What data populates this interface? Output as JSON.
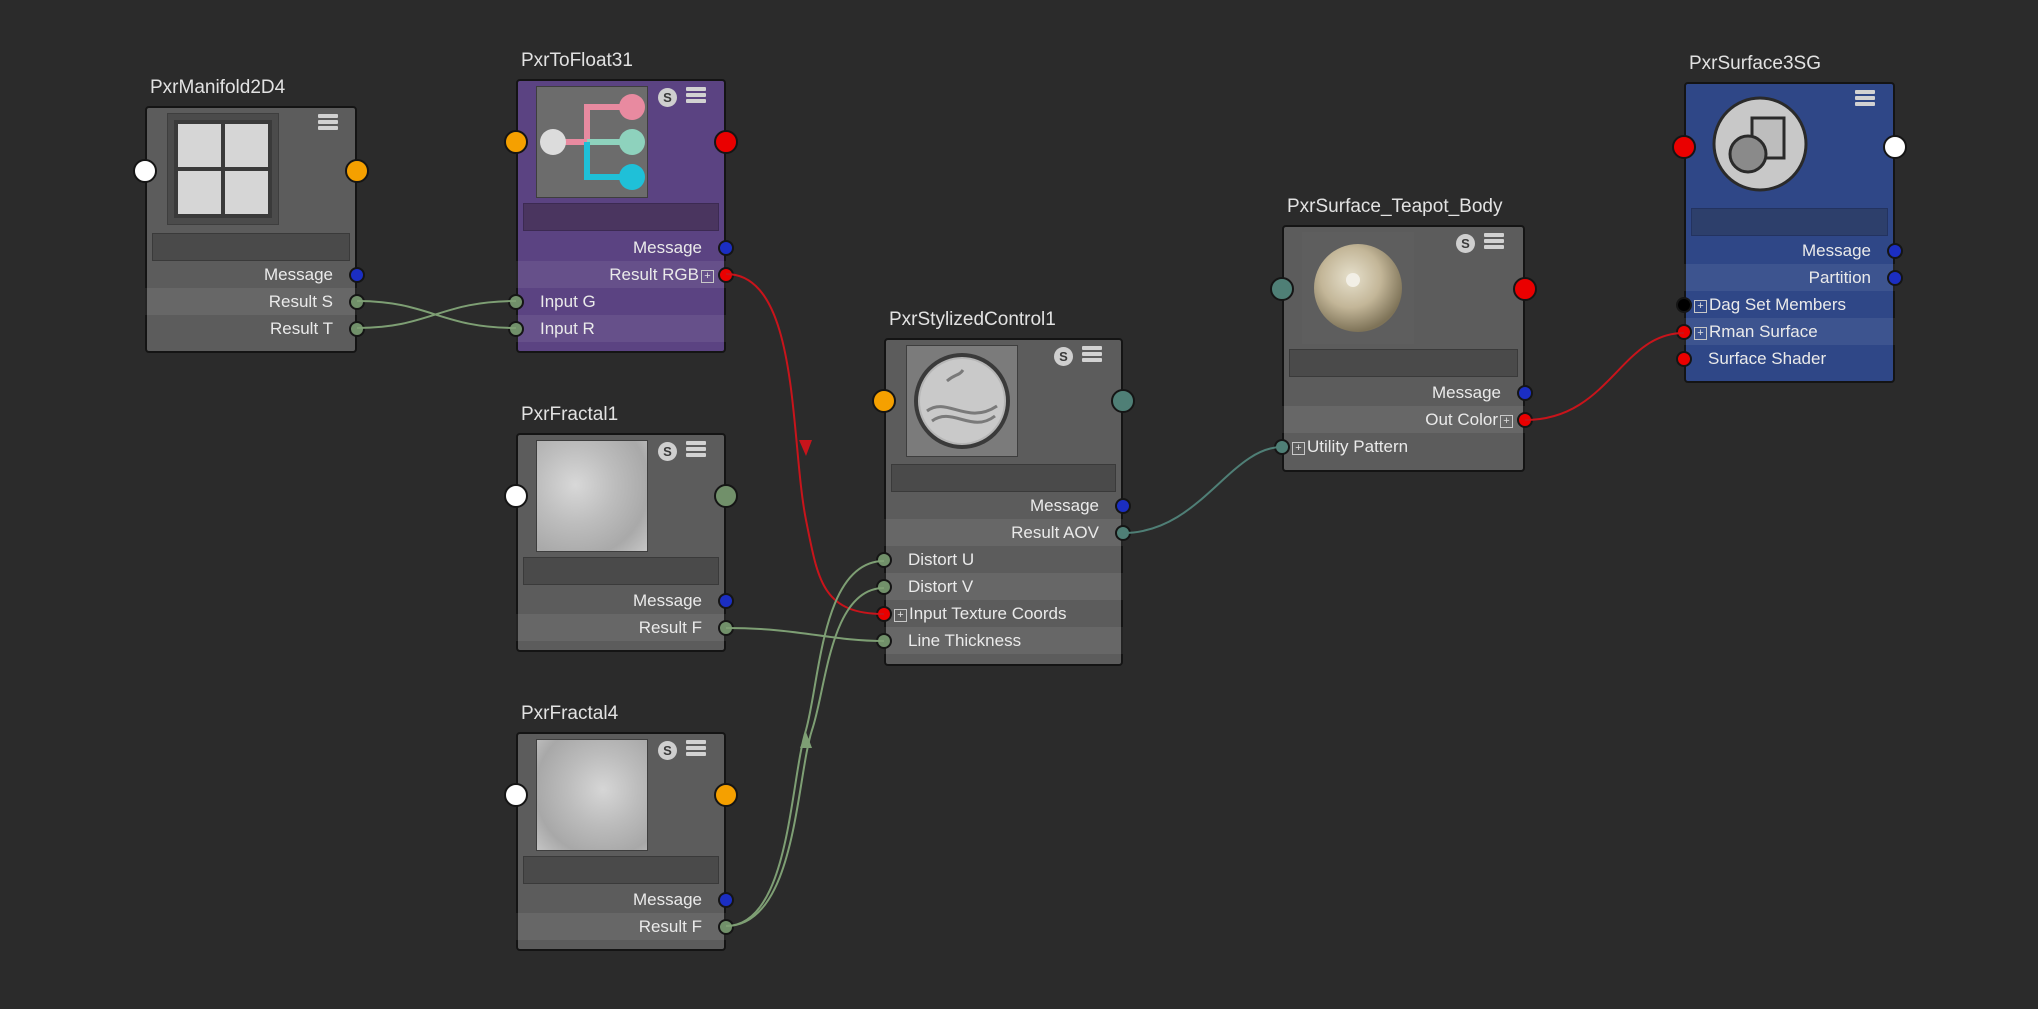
{
  "colors": {
    "background": "#2b2b2b",
    "node_gray": "#5c5c5c",
    "node_purple": "#5b4382",
    "node_blue": "#2f4787",
    "port_orange": "#f5a000",
    "port_red": "#ea0000",
    "port_blue": "#1b2ec2",
    "port_green": "#71906a",
    "port_teal": "#4f7f76",
    "port_white": "#ffffff",
    "port_black": "#000000",
    "wire_green": "#7e9f74",
    "wire_red": "#c8141b"
  },
  "nodes": {
    "manifold": {
      "title": "PxrManifold2D4",
      "swatch_icon": "grid-icon",
      "rows": {
        "message": "Message",
        "result_s": "Result S",
        "result_t": "Result T"
      }
    },
    "tofloat": {
      "title": "PxrToFloat31",
      "swatch_icon": "split-channels-icon",
      "rows": {
        "message": "Message",
        "result_rgb": "Result RGB",
        "input_g": "Input G",
        "input_r": "Input R"
      }
    },
    "fractal1": {
      "title": "PxrFractal1",
      "swatch_icon": "fractal-noise-swatch",
      "rows": {
        "message": "Message",
        "result_f": "Result F"
      }
    },
    "fractal4": {
      "title": "PxrFractal4",
      "swatch_icon": "fractal-noise-swatch",
      "rows": {
        "message": "Message",
        "result_f": "Result F"
      }
    },
    "stylized": {
      "title": "PxrStylizedControl1",
      "swatch_icon": "stylized-sphere-swatch",
      "rows": {
        "message": "Message",
        "result_aov": "Result AOV",
        "distort_u": "Distort U",
        "distort_v": "Distort V",
        "input_texture_coords": "Input Texture Coords",
        "line_thickness": "Line Thickness"
      }
    },
    "teapot": {
      "title": "PxrSurface_Teapot_Body",
      "swatch_icon": "shaded-sphere-swatch",
      "rows": {
        "message": "Message",
        "out_color": "Out Color",
        "utility_pattern": "Utility Pattern"
      }
    },
    "surface_sg": {
      "title": "PxrSurface3SG",
      "swatch_icon": "shading-group-icon",
      "rows": {
        "message": "Message",
        "partition": "Partition",
        "dag_set_members": "Dag Set Members",
        "rman_surface": "Rman Surface",
        "surface_shader": "Surface Shader"
      }
    }
  },
  "icons": {
    "swatch_toggle": "S",
    "menu": "menu-icon",
    "expand": "+"
  }
}
